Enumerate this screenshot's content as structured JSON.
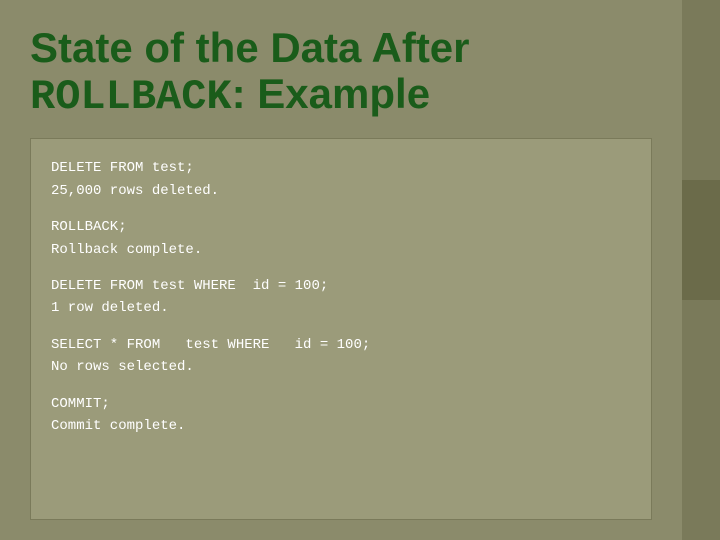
{
  "page": {
    "background_color": "#8b8b6b"
  },
  "title": {
    "line1": "State of the Data After",
    "line2_prefix": "ROLLBACK",
    "line2_suffix": ": Example"
  },
  "code": {
    "sections": [
      {
        "lines": [
          "DELETE FROM test;",
          "25,000 rows deleted."
        ]
      },
      {
        "lines": [
          "ROLLBACK;",
          "Rollback complete."
        ]
      },
      {
        "lines": [
          "DELETE FROM test WHERE  id = 100;",
          "1 row deleted."
        ]
      },
      {
        "lines": [
          "SELECT * FROM   test WHERE   id = 100;",
          "No rows selected."
        ]
      },
      {
        "lines": [
          "COMMIT;",
          "Commit complete."
        ]
      }
    ]
  }
}
